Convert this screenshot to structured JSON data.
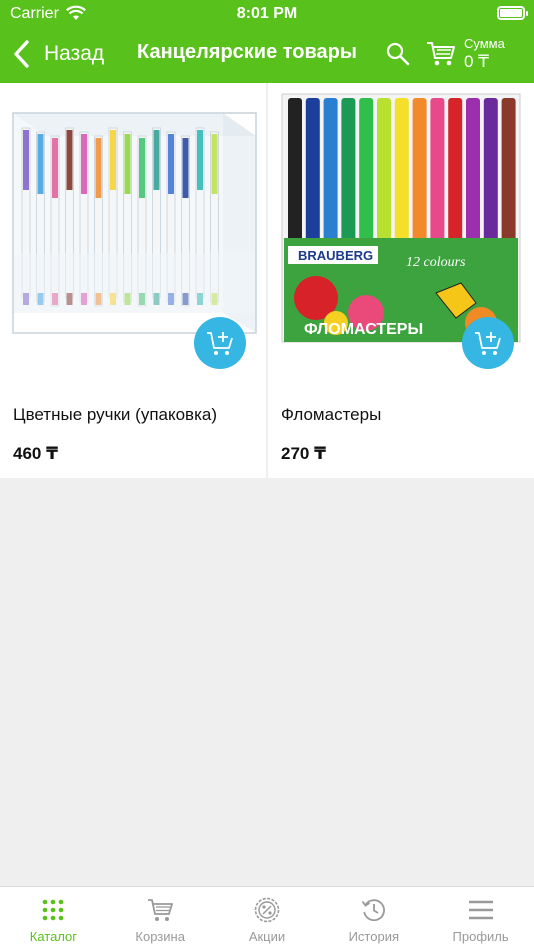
{
  "status_bar": {
    "carrier": "Carrier",
    "time": "8:01 PM"
  },
  "header": {
    "back_label": "Назад",
    "title": "Канцелярские товары",
    "sum_label": "Сумма",
    "sum_value": "0 ₸"
  },
  "products": [
    {
      "name": "Цветные ручки (упаковка)",
      "price": "460 ₸",
      "image": "gel-pens-box"
    },
    {
      "name": "Фломастеры",
      "price": "270 ₸",
      "image": "brauberg-markers",
      "package_text": {
        "brand": "BRAUBERG",
        "colors": "12 colours",
        "label": "ФЛОМАСТЕРЫ"
      }
    }
  ],
  "tabs": [
    {
      "label": "Каталог",
      "icon": "grid-icon",
      "active": true
    },
    {
      "label": "Корзина",
      "icon": "cart-icon",
      "active": false
    },
    {
      "label": "Акции",
      "icon": "percent-icon",
      "active": false
    },
    {
      "label": "История",
      "icon": "history-icon",
      "active": false
    },
    {
      "label": "Профиль",
      "icon": "menu-icon",
      "active": false
    }
  ],
  "colors": {
    "brand": "#59c11b",
    "accent": "#36b6e3",
    "background": "#efefef"
  }
}
